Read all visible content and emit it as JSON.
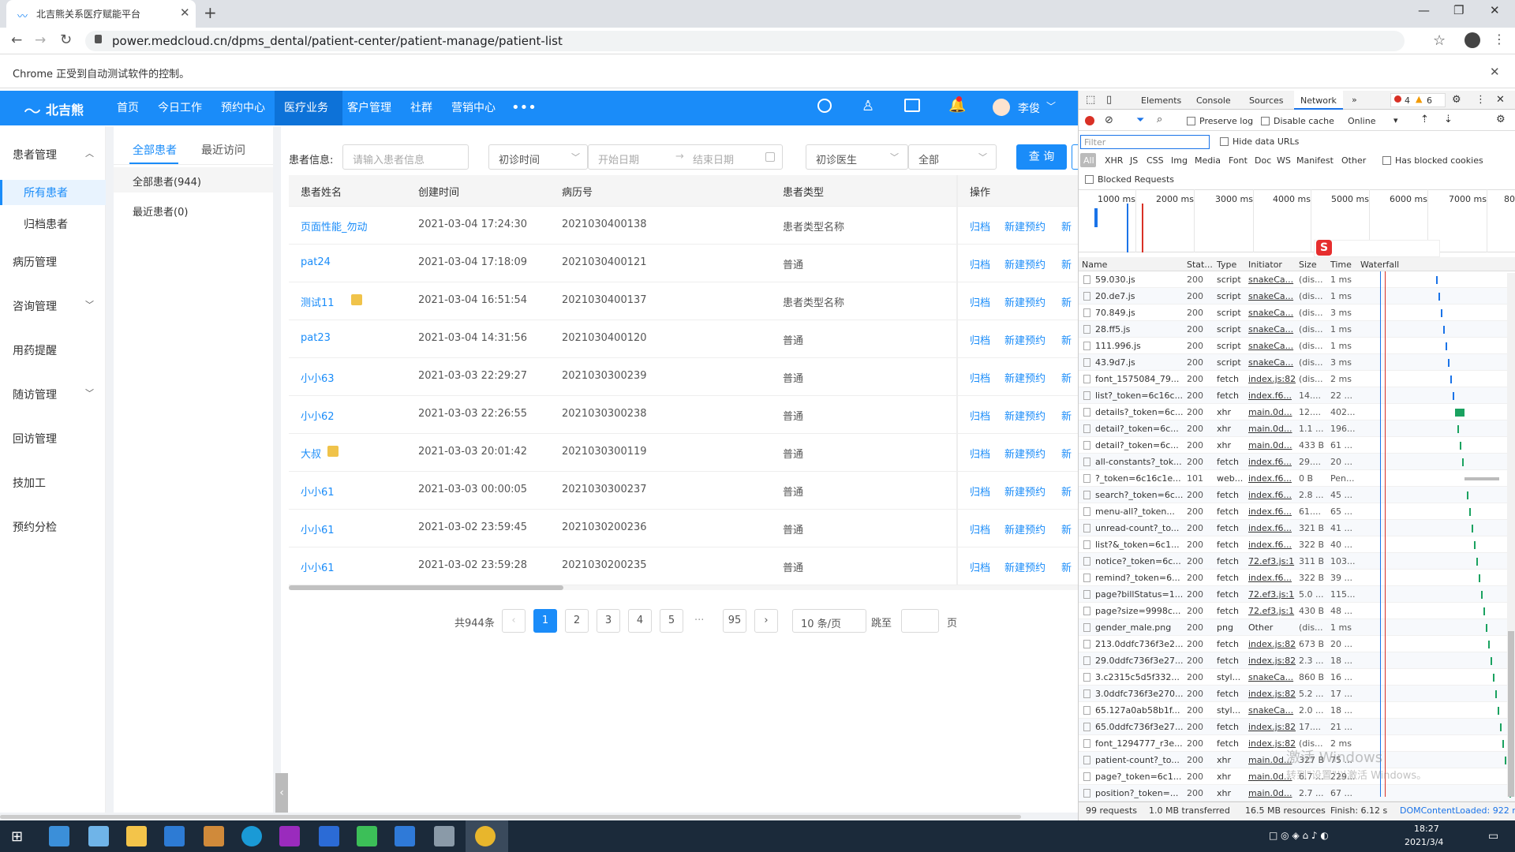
{
  "browser": {
    "tab_title": "北吉熊关系医疗赋能平台",
    "url": "power.medcloud.cn/dpms_dental/patient-center/patient-manage/patient-list",
    "infobar": "Chrome 正受到自动测试软件的控制。"
  },
  "app": {
    "logo": "北吉熊",
    "nav": [
      "首页",
      "今日工作",
      "预约中心",
      "医疗业务",
      "客户管理",
      "社群",
      "营销中心"
    ],
    "user": "李俊"
  },
  "sidebar": [
    "患者管理",
    "所有患者",
    "归档患者",
    "病历管理",
    "咨询管理",
    "用药提醒",
    "随访管理",
    "回访管理",
    "技加工",
    "预约分检"
  ],
  "subpanel": {
    "tabs": [
      "全部患者",
      "最近访问"
    ],
    "items": [
      "全部患者(944)",
      "最近患者(0)"
    ]
  },
  "filters": {
    "label": "患者信息:",
    "patient_placeholder": "请输入患者信息",
    "date_type": "初诊时间",
    "start_date": "开始日期",
    "end_date": "结束日期",
    "doctor": "初诊医生",
    "scope": "全部",
    "query_button": "查 询"
  },
  "table": {
    "headers": [
      "患者姓名",
      "创建时间",
      "病历号",
      "患者类型",
      "操作"
    ],
    "rows": [
      {
        "name": "页面性能_勿动",
        "time": "2021-03-04 17:24:30",
        "no": "2021030400138",
        "type": "患者类型名称",
        "badge": false
      },
      {
        "name": "pat24",
        "time": "2021-03-04 17:18:09",
        "no": "2021030400121",
        "type": "普通",
        "badge": false
      },
      {
        "name": "测试11",
        "time": "2021-03-04 16:51:54",
        "no": "2021030400137",
        "type": "患者类型名称",
        "badge": true
      },
      {
        "name": "pat23",
        "time": "2021-03-04 14:31:56",
        "no": "2021030400120",
        "type": "普通",
        "badge": false
      },
      {
        "name": "小小63",
        "time": "2021-03-03 22:29:27",
        "no": "2021030300239",
        "type": "普通",
        "badge": false
      },
      {
        "name": "小小62",
        "time": "2021-03-03 22:26:55",
        "no": "2021030300238",
        "type": "普通",
        "badge": false
      },
      {
        "name": "大叔",
        "time": "2021-03-03 20:01:42",
        "no": "2021030300119",
        "type": "普通",
        "badge": true
      },
      {
        "name": "小小61",
        "time": "2021-03-03 00:00:05",
        "no": "2021030300237",
        "type": "普通",
        "badge": false
      },
      {
        "name": "小小61",
        "time": "2021-03-02 23:59:45",
        "no": "2021030200236",
        "type": "普通",
        "badge": false
      },
      {
        "name": "小小61",
        "time": "2021-03-02 23:59:28",
        "no": "2021030200235",
        "type": "普通",
        "badge": false
      }
    ],
    "actions": [
      "归档",
      "新建预约",
      "新"
    ]
  },
  "pagination": {
    "total": "共944条",
    "pages": [
      "1",
      "2",
      "3",
      "4",
      "5"
    ],
    "ellipsis": "···",
    "last": "95",
    "page_size": "10 条/页",
    "jump": "跳至",
    "page_unit": "页"
  },
  "devtools": {
    "tabs": [
      "Elements",
      "Console",
      "Sources",
      "Network"
    ],
    "errors": "4",
    "warnings": "6",
    "preserve_log": "Preserve log",
    "disable_cache": "Disable cache",
    "throttle": "Online",
    "filter_placeholder": "Filter",
    "hide_data_urls": "Hide data URLs",
    "types": [
      "All",
      "XHR",
      "JS",
      "CSS",
      "Img",
      "Media",
      "Font",
      "Doc",
      "WS",
      "Manifest",
      "Other"
    ],
    "blocked_cookies": "Has blocked cookies",
    "blocked_requests": "Blocked Requests",
    "timeline": [
      "1000 ms",
      "2000 ms",
      "3000 ms",
      "4000 ms",
      "5000 ms",
      "6000 ms",
      "7000 ms",
      "80"
    ],
    "columns": [
      "Name",
      "Stat...",
      "Type",
      "Initiator",
      "Size",
      "Time",
      "Waterfall"
    ],
    "requests": [
      [
        "59.030.js",
        "200",
        "script",
        "snakeCa...",
        "(dis...",
        "1 ms"
      ],
      [
        "20.de7.js",
        "200",
        "script",
        "snakeCa...",
        "(dis...",
        "1 ms"
      ],
      [
        "70.849.js",
        "200",
        "script",
        "snakeCa...",
        "(dis...",
        "3 ms"
      ],
      [
        "28.ff5.js",
        "200",
        "script",
        "snakeCa...",
        "(dis...",
        "1 ms"
      ],
      [
        "111.996.js",
        "200",
        "script",
        "snakeCa...",
        "(dis...",
        "1 ms"
      ],
      [
        "43.9d7.js",
        "200",
        "script",
        "snakeCa...",
        "(dis...",
        "3 ms"
      ],
      [
        "font_1575084_79...",
        "200",
        "fetch",
        "index.js:82",
        "(dis...",
        "2 ms"
      ],
      [
        "list?_token=6c16c...",
        "200",
        "fetch",
        "index.f6...",
        "14....",
        "22 ..."
      ],
      [
        "details?_token=6c...",
        "200",
        "xhr",
        "main.0d...",
        "12....",
        "402..."
      ],
      [
        "detail?_token=6c...",
        "200",
        "xhr",
        "main.0d...",
        "1.1 ...",
        "196..."
      ],
      [
        "detail?_token=6c...",
        "200",
        "xhr",
        "main.0d...",
        "433 B",
        "61 ..."
      ],
      [
        "all-constants?_tok...",
        "200",
        "fetch",
        "index.f6...",
        "29....",
        "20 ..."
      ],
      [
        "?_token=6c16c1e...",
        "101",
        "web...",
        "index.f6...",
        "0 B",
        "Pen..."
      ],
      [
        "search?_token=6c...",
        "200",
        "fetch",
        "index.f6...",
        "2.8 ...",
        "45 ..."
      ],
      [
        "menu-all?_token...",
        "200",
        "fetch",
        "index.f6...",
        "61....",
        "65 ..."
      ],
      [
        "unread-count?_to...",
        "200",
        "fetch",
        "index.f6...",
        "321 B",
        "41 ..."
      ],
      [
        "list?&_token=6c1...",
        "200",
        "fetch",
        "index.f6...",
        "322 B",
        "40 ..."
      ],
      [
        "notice?_token=6c...",
        "200",
        "fetch",
        "72.ef3.js:1",
        "311 B",
        "103..."
      ],
      [
        "remind?_token=6...",
        "200",
        "fetch",
        "index.f6...",
        "322 B",
        "39 ..."
      ],
      [
        "page?billStatus=1...",
        "200",
        "fetch",
        "72.ef3.js:1",
        "5.0 ...",
        "115..."
      ],
      [
        "page?size=9998c...",
        "200",
        "fetch",
        "72.ef3.js:1",
        "430 B",
        "48 ..."
      ],
      [
        "gender_male.png",
        "200",
        "png",
        "Other",
        "(dis...",
        "1 ms"
      ],
      [
        "213.0ddfc736f3e2...",
        "200",
        "fetch",
        "index.js:82",
        "673 B",
        "20 ..."
      ],
      [
        "29.0ddfc736f3e27...",
        "200",
        "fetch",
        "index.js:82",
        "2.3 ...",
        "18 ..."
      ],
      [
        "3.c2315c5d5f332...",
        "200",
        "styl...",
        "snakeCa...",
        "860 B",
        "16 ..."
      ],
      [
        "3.0ddfc736f3e270...",
        "200",
        "fetch",
        "index.js:82",
        "5.2 ...",
        "17 ..."
      ],
      [
        "65.127a0ab58b1f...",
        "200",
        "styl...",
        "snakeCa...",
        "2.0 ...",
        "18 ..."
      ],
      [
        "65.0ddfc736f3e27...",
        "200",
        "fetch",
        "index.js:82",
        "17....",
        "21 ..."
      ],
      [
        "font_1294777_r3e...",
        "200",
        "fetch",
        "index.js:82",
        "(dis...",
        "2 ms"
      ],
      [
        "patient-count?_to...",
        "200",
        "xhr",
        "main.0d...",
        "327 B",
        "75 ..."
      ],
      [
        "page?_token=6c1...",
        "200",
        "xhr",
        "main.0d...",
        "6.7 ...",
        "229..."
      ],
      [
        "position?_token=...",
        "200",
        "xhr",
        "main.0d...",
        "2.7 ...",
        "67 ..."
      ]
    ],
    "status_bar": [
      "99 requests",
      "1.0 MB transferred",
      "16.5 MB resources",
      "Finish: 6.12 s",
      "DOMContentLoaded: 922 r"
    ]
  },
  "watermark": [
    "激活 Windows",
    "转到\"设置\"以激活 Windows。"
  ],
  "taskbar": {
    "time": "18:27",
    "date": "2021/3/4"
  },
  "colors": {
    "primary": "#1a8cf9",
    "nav_active": "#0d72d8",
    "taskbar": "#1b2a3a"
  }
}
